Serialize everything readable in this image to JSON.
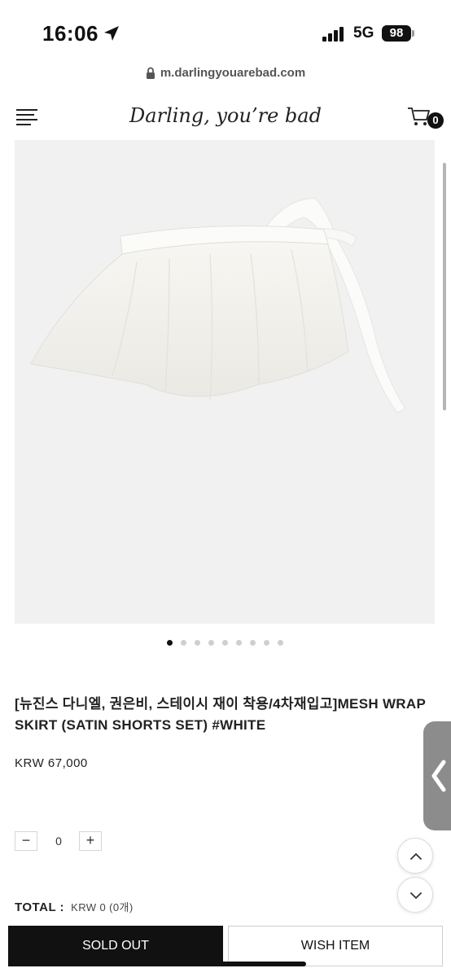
{
  "status_bar": {
    "time": "16:06",
    "network": "5G",
    "battery": "98"
  },
  "browser": {
    "url": "m.darlingyouarebad.com"
  },
  "header": {
    "logo": "Darling, you’re bad",
    "cart_count": "0"
  },
  "gallery": {
    "image_count": 9,
    "active_index": 0
  },
  "product": {
    "title": "[뉴진스 다니엘, 권은비, 스테이시 재이 착용/4차재입고]MESH WRAP SKIRT (SATIN SHORTS SET) #WHITE",
    "price": "KRW 67,000"
  },
  "quantity": {
    "minus": "−",
    "value": "0",
    "plus": "+"
  },
  "total": {
    "label": "TOTAL :",
    "value": "KRW 0 (0개)"
  },
  "actions": {
    "sold_out": "SOLD OUT",
    "wish_item": "WISH ITEM"
  },
  "icons": {
    "menu": "hamburger-menu-icon",
    "cart": "shopping-cart-icon",
    "lock": "lock-icon",
    "location": "location-arrow-icon",
    "side_tab": "chevron-left-icon",
    "scroll_up": "chevron-up-icon",
    "scroll_down": "chevron-down-icon"
  },
  "colors": {
    "primary_button": "#111111",
    "image_background": "#f1f1f1",
    "side_tab": "#8c8c8c"
  }
}
